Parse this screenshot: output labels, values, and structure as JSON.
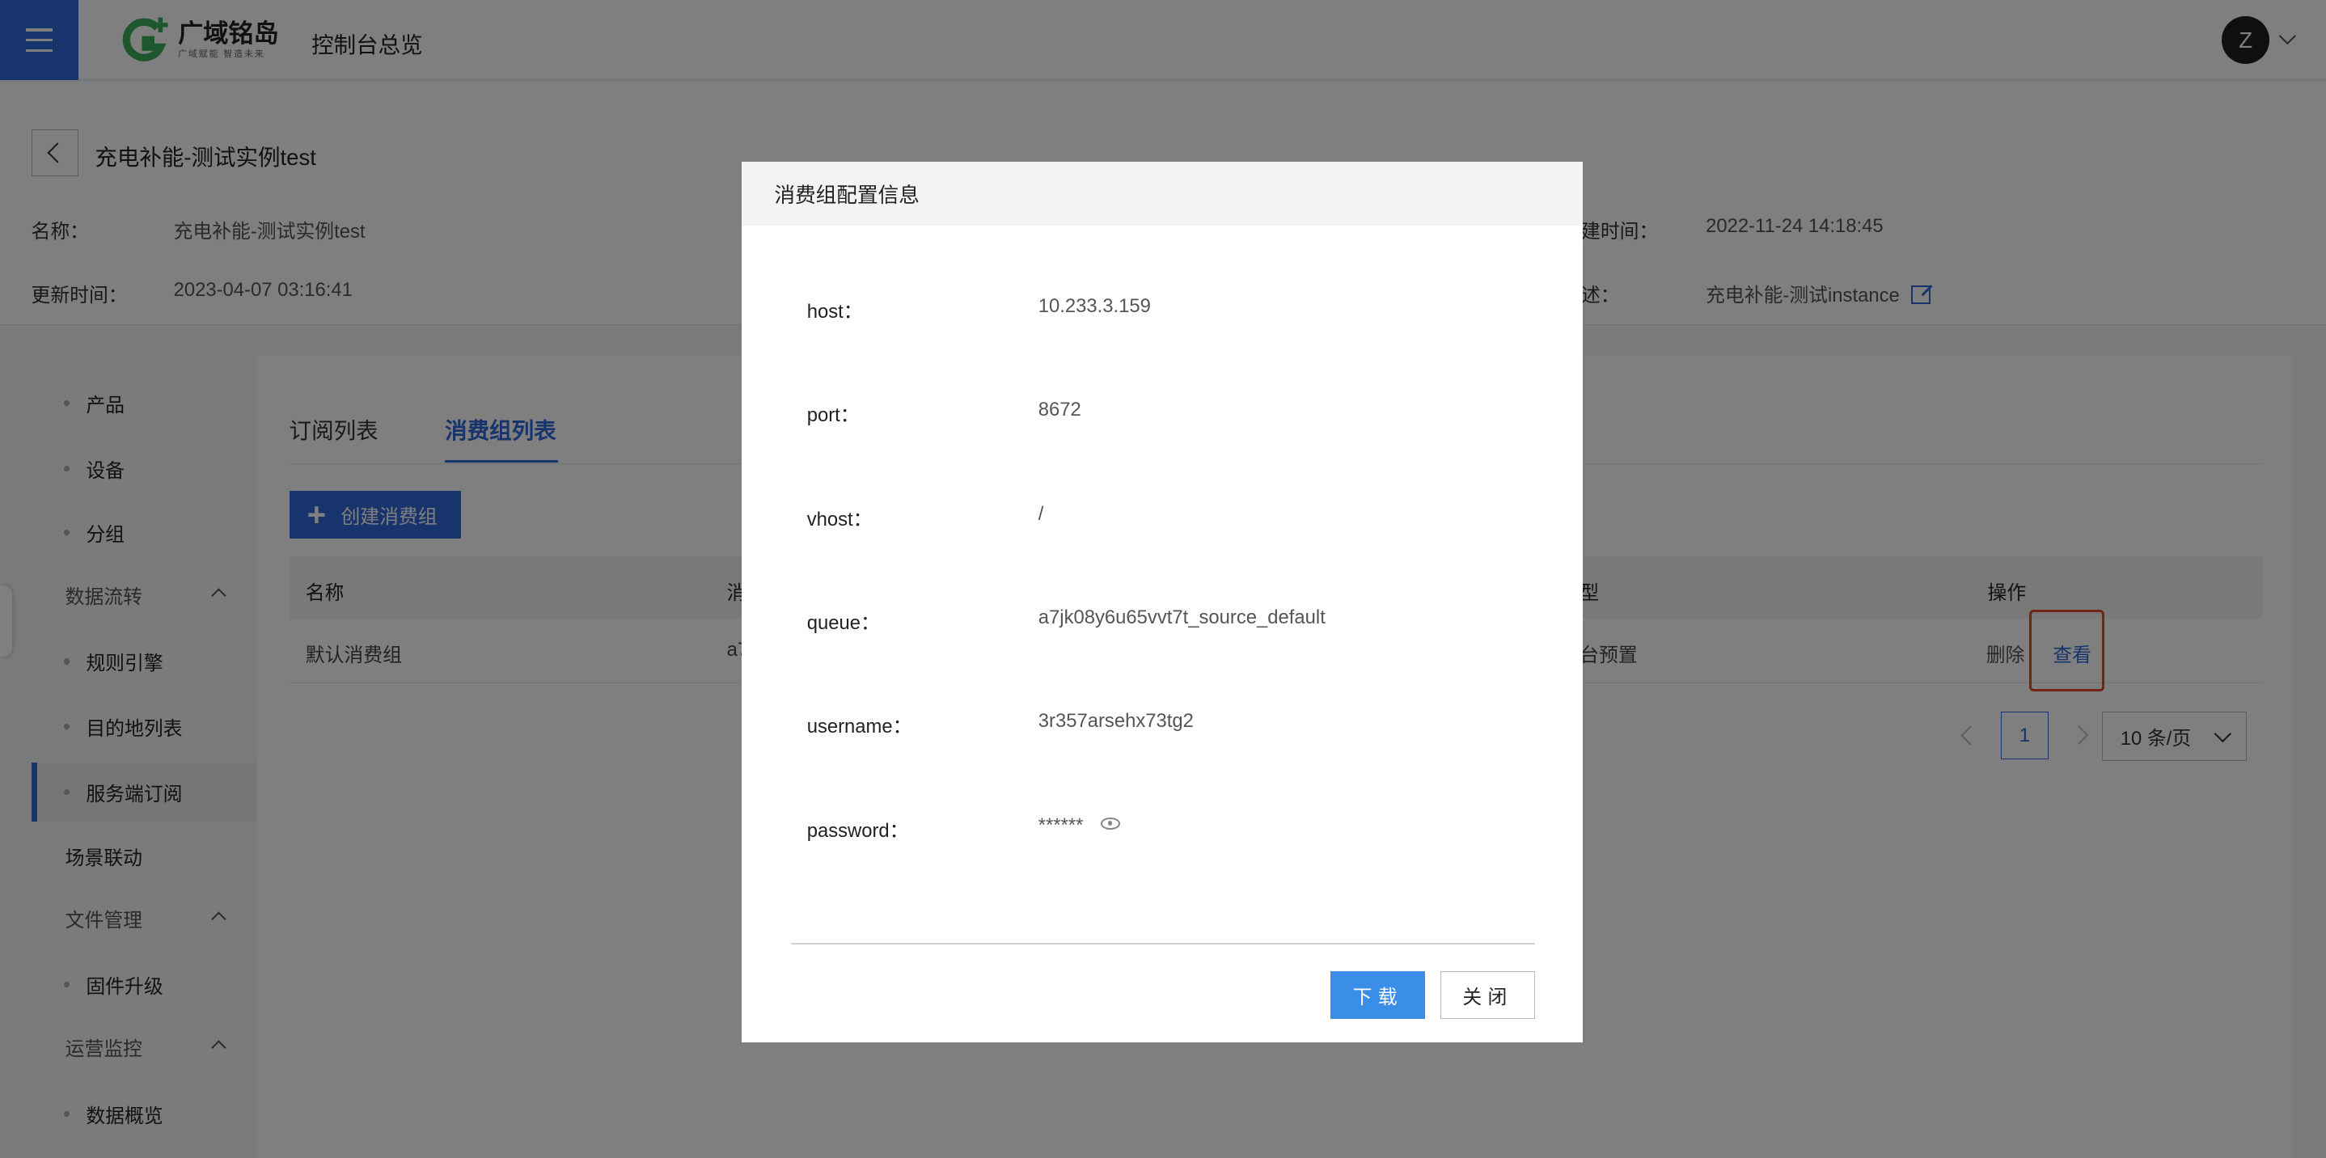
{
  "header": {
    "brand": "广域铭岛",
    "brand_sub": "广域赋能 智造未来",
    "console_title": "控制台总览",
    "avatar_initial": "Z"
  },
  "detail": {
    "title": "充电补能-测试实例test",
    "name_label": "名称：",
    "name_value": "充电补能-测试实例test",
    "updated_label": "更新时间：",
    "updated_value": "2023-04-07 03:16:41",
    "created_label": "建时间：",
    "created_value": "2022-11-24 14:18:45",
    "desc_label": "述：",
    "desc_value": "充电补能-测试instance"
  },
  "sidebar": {
    "items": [
      {
        "label": "产品",
        "kind": "sub"
      },
      {
        "label": "设备",
        "kind": "sub"
      },
      {
        "label": "分组",
        "kind": "sub"
      },
      {
        "label": "数据流转",
        "kind": "group"
      },
      {
        "label": "规则引擎",
        "kind": "sub"
      },
      {
        "label": "目的地列表",
        "kind": "sub"
      },
      {
        "label": "服务端订阅",
        "kind": "sub",
        "active": true
      },
      {
        "label": "场景联动",
        "kind": "top"
      },
      {
        "label": "文件管理",
        "kind": "group"
      },
      {
        "label": "固件升级",
        "kind": "sub"
      },
      {
        "label": "运营监控",
        "kind": "group"
      },
      {
        "label": "数据概览",
        "kind": "sub"
      }
    ]
  },
  "tabs": [
    {
      "label": "订阅列表"
    },
    {
      "label": "消费组列表",
      "active": true
    }
  ],
  "create_button": "创建消费组",
  "table": {
    "headers": [
      "名称",
      "消",
      "型",
      "操作"
    ],
    "rows": [
      {
        "name": "默认消费组",
        "col2": "a7",
        "type": "台预置",
        "delete": "删除",
        "view": "查看"
      }
    ]
  },
  "pagination": {
    "current_page": "1",
    "page_size": "10 条/页"
  },
  "modal": {
    "title": "消费组配置信息",
    "fields": [
      {
        "label": "host：",
        "value": "10.233.3.159"
      },
      {
        "label": "port：",
        "value": "8672"
      },
      {
        "label": "vhost：",
        "value": "/"
      },
      {
        "label": "queue：",
        "value": "a7jk08y6u65vvt7t_source_default"
      },
      {
        "label": "username：",
        "value": "3r357arsehx73tg2"
      },
      {
        "label": "password：",
        "value": "******"
      }
    ],
    "download": "下载",
    "close": "关闭"
  },
  "colors": {
    "accent": "#2f68d8",
    "download_button": "#3b8ee8",
    "highlight_box": "#e54b2e"
  }
}
